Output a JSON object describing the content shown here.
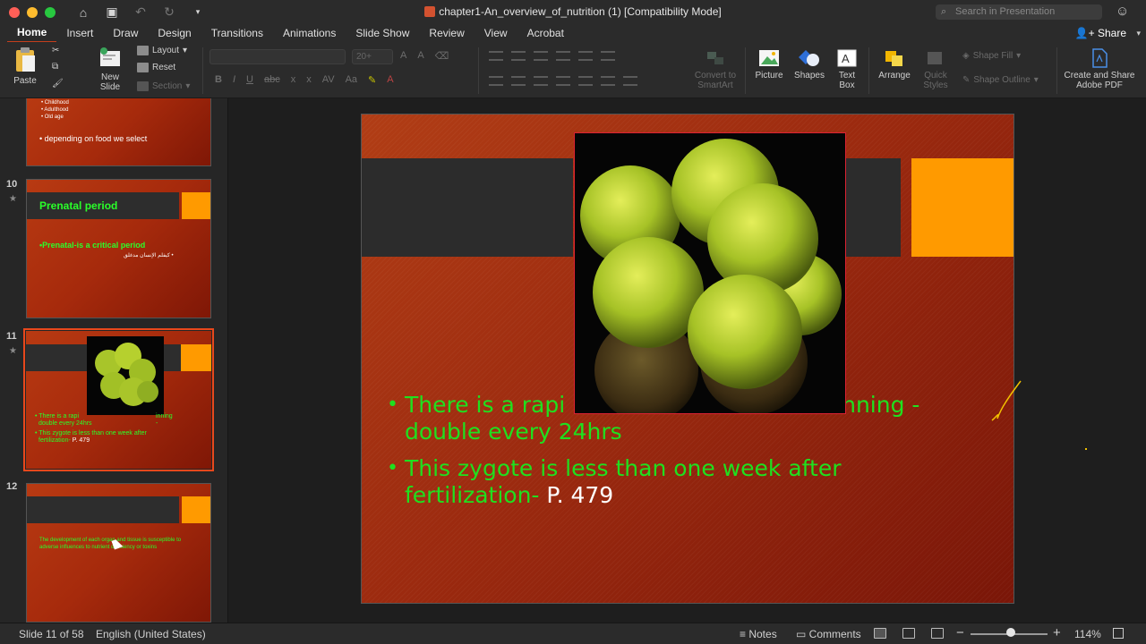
{
  "window": {
    "title": "chapter1-An_overview_of_nutrition (1) [Compatibility Mode]",
    "search_placeholder": "Search in Presentation"
  },
  "tabs": [
    "Home",
    "Insert",
    "Draw",
    "Design",
    "Transitions",
    "Animations",
    "Slide Show",
    "Review",
    "View",
    "Acrobat"
  ],
  "active_tab": "Home",
  "share_label": "Share",
  "ribbon": {
    "paste": "Paste",
    "new_slide_1": "New",
    "new_slide_2": "Slide",
    "layout": "Layout",
    "reset": "Reset",
    "section": "Section",
    "font_size": "20+",
    "convert_1": "Convert to",
    "convert_2": "SmartArt",
    "picture": "Picture",
    "shapes": "Shapes",
    "textbox_1": "Text",
    "textbox_2": "Box",
    "arrange": "Arrange",
    "quick_styles_1": "Quick",
    "quick_styles_2": "Styles",
    "shape_fill": "Shape Fill",
    "shape_outline": "Shape Outline",
    "acrobat_1": "Create and Share",
    "acrobat_2": "Adobe PDF"
  },
  "thumbnails": {
    "slide9": {
      "lines": [
        "• Childhood",
        "• Adulthood",
        "• Old age"
      ],
      "bullet": "• depending on food we select"
    },
    "slide10": {
      "number": "10",
      "title": "Prenatal period",
      "bullet": "•Prenatal-is a critical period",
      "arabic": "كيفلم الإنسان مدغلق •"
    },
    "slide11": {
      "number": "11",
      "line1": "• There is a rapi",
      "line1b": "inning -",
      "line2": "double every 24hrs",
      "line3": "• This zygote is less than one week after",
      "line4": "fertilization-",
      "page": "P. 479"
    },
    "slide12": {
      "number": "12",
      "line1": "The development of each organ and tissue is susceptible to",
      "line2": "adverse influences to nutrient deficiency or toxins"
    }
  },
  "slide": {
    "bullet1_a": "There is a rapi",
    "bullet1_b": "inning -",
    "bullet1_line2": "double every 24hrs",
    "bullet2_line1": "This zygote is less than one week after",
    "bullet2_line2": "fertilization-",
    "bullet2_page": "P. 479"
  },
  "status": {
    "slide_count": "Slide 11 of 58",
    "language": "English (United States)",
    "notes": "Notes",
    "comments": "Comments",
    "zoom": "114%"
  },
  "colors": {
    "slide_text_green": "#1fe01f",
    "accent_orange": "#ff9a00",
    "selected_outline": "#e8481c"
  }
}
